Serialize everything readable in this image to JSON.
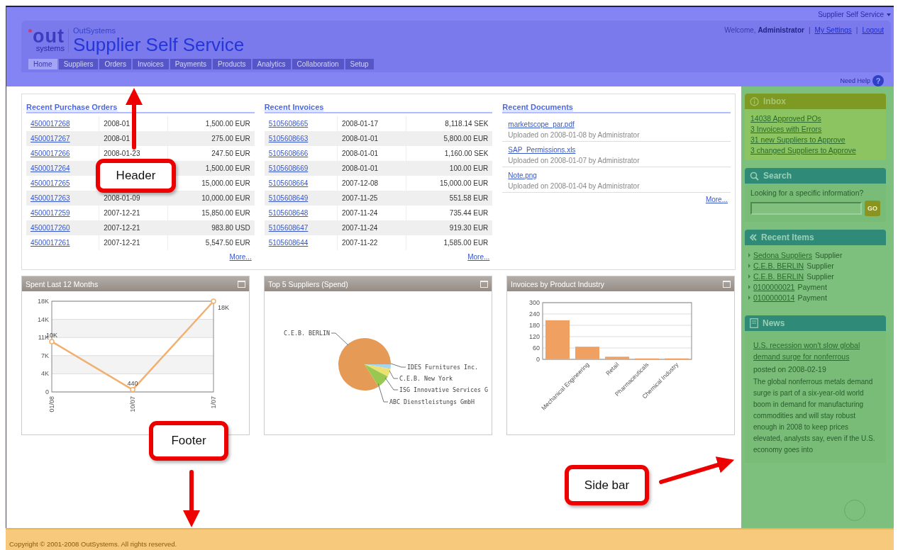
{
  "header": {
    "app_switcher": "Supplier Self Service",
    "logo": {
      "mark": "out",
      "sub": "systems"
    },
    "brand": "OutSystems",
    "title": "Supplier Self Service",
    "welcome": "Welcome, **Administrator**",
    "separator": "|",
    "links": [
      "My Settings",
      "Logout"
    ],
    "tabs": [
      {
        "label": "Home",
        "selected": true
      },
      {
        "label": "Suppliers",
        "selected": false
      },
      {
        "label": "Orders",
        "selected": false
      },
      {
        "label": "Invoices",
        "selected": false
      },
      {
        "label": "Payments",
        "selected": false
      },
      {
        "label": "Products",
        "selected": false
      },
      {
        "label": "Analytics",
        "selected": false
      },
      {
        "label": "Collaboration",
        "selected": false
      },
      {
        "label": "Setup",
        "selected": false
      }
    ],
    "help": {
      "label": "Need Help",
      "icon": "?"
    }
  },
  "purchase_orders": {
    "title": "Recent Purchase Orders",
    "more": "More...",
    "rows": [
      {
        "number": "4500017268",
        "date": "2008-01",
        "amount": "1,500.00 EUR"
      },
      {
        "number": "4500017267",
        "date": "2008-01",
        "amount": "275.00 EUR"
      },
      {
        "number": "4500017266",
        "date": "2008-01-23",
        "amount": "247.50 EUR"
      },
      {
        "number": "4500017264",
        "amount": "1,500.00 EUR"
      },
      {
        "number": "4500017265",
        "amount": "15,000.00 EUR"
      },
      {
        "number": "4500017263",
        "date": "2008-01-09",
        "amount": "10,000.00 EUR"
      },
      {
        "number": "4500017259",
        "date": "2007-12-21",
        "amount": "15,850.00 EUR"
      },
      {
        "number": "4500017260",
        "date": "2007-12-21",
        "amount": "983.80 USD"
      },
      {
        "number": "4500017261",
        "date": "2007-12-21",
        "amount": "5,547.50 EUR"
      }
    ]
  },
  "invoices": {
    "title": "Recent Invoices",
    "more": "More...",
    "rows": [
      {
        "number": "5105608665",
        "date": "2008-01-17",
        "amount": "8,118.14 SEK"
      },
      {
        "number": "5105608663",
        "date": "2008-01-01",
        "amount": "5,800.00 EUR"
      },
      {
        "number": "5105608666",
        "date": "2008-01-01",
        "amount": "1,160.00 SEK"
      },
      {
        "number": "5105608669",
        "date": "2008-01-01",
        "amount": "100.00 EUR"
      },
      {
        "number": "5105608664",
        "date": "2007-12-08",
        "amount": "15,000.00 EUR"
      },
      {
        "number": "5105608649",
        "date": "2007-11-25",
        "amount": "551.58 EUR"
      },
      {
        "number": "5105608648",
        "date": "2007-11-24",
        "amount": "735.44 EUR"
      },
      {
        "number": "5105608647",
        "date": "2007-11-24",
        "amount": "919.30 EUR"
      },
      {
        "number": "5105608644",
        "date": "2007-11-22",
        "amount": "1,585.00 EUR"
      }
    ]
  },
  "documents": {
    "title": "Recent Documents",
    "more": "More...",
    "items": [
      {
        "name": "marketscope_par.pdf",
        "info": "Uploaded on 2008-01-08 by Administrator"
      },
      {
        "name": "SAP_Permissions.xls",
        "info": "Uploaded on 2008-01-07 by Administrator"
      },
      {
        "name": "Note.png",
        "info": "Uploaded on 2008-01-04 by Administrator"
      }
    ]
  },
  "spent_chart": {
    "title": "Spent Last 12 Months",
    "chart_data": {
      "type": "line",
      "categories": [
        "01/08",
        "10/07",
        "1/07"
      ],
      "series": [
        {
          "color": "#f0b070",
          "marker": "o",
          "values": [
            10000,
            440,
            18000
          ]
        }
      ],
      "grid": true,
      "ylim": [
        0,
        18000
      ],
      "yticks": [
        {
          "value": 0,
          "label": "0"
        },
        {
          "value": 3600,
          "label": "4K"
        },
        {
          "value": 7200,
          "label": "7K"
        },
        {
          "value": 10800,
          "label": "11K"
        },
        {
          "value": 14400,
          "label": "14K"
        },
        {
          "value": 18000,
          "label": "18K"
        }
      ],
      "value_labels": [
        "10K",
        "440",
        "18K"
      ]
    }
  },
  "suppliers_chart": {
    "title": "Top 5 Suppliers (Spend)",
    "labels": [
      "C.E.B. BERLIN",
      "IDES Furnitures Inc.",
      "C.E.B. New York",
      "ISG Innovative Services G",
      "ABC Dienstleistungs GmbH"
    ]
  },
  "industry_chart": {
    "title": "Invoices by Product Industry",
    "chart_data": {
      "type": "bar",
      "categories": [
        null,
        "Mechanical Engineering",
        "Retail",
        "Pharmaceuticals",
        "Chemical Industry"
      ],
      "series": [
        {
          "color": "#f0a060",
          "values": [
            205,
            65,
            12,
            3,
            3
          ]
        }
      ],
      "grid": true,
      "ylim": [
        0,
        300
      ],
      "yticks": [
        0,
        60,
        120,
        180,
        240,
        300
      ]
    }
  },
  "sidebar": {
    "inbox": {
      "title": "Inbox",
      "items": [
        "14038 Approved POs",
        "3 Invoices with Errors",
        "31 new Suppliers to Approve",
        "3 changed Suppliers to Approve"
      ]
    },
    "search": {
      "title": "Search",
      "prompt": "Looking for a specific information?",
      "button": "GO"
    },
    "recent": {
      "title": "Recent Items",
      "items": [
        {
          "name": "Sedona Suppliers",
          "type": "Supplier"
        },
        {
          "name": "C.E.B. BERLIN",
          "type": "Supplier"
        },
        {
          "name": "C.E.B. BERLIN",
          "type": "Supplier"
        },
        {
          "name": "0100000021",
          "type": "Payment"
        },
        {
          "name": "0100000014",
          "type": "Payment"
        }
      ]
    },
    "news": {
      "title": "News",
      "headline": "U.S. recession won't slow global demand surge for nonferrous",
      "posted": "posted on 2008-02-19",
      "body": "The global nonferrous metals demand surge is part of a six-year-old world boom in demand for manufacturing commodities and will stay robust enough in 2008 to keep prices elevated, analysts say, even if the U.S. economy goes into"
    }
  },
  "footer": {
    "copyright": "Copyright © 2001-2008 OutSystems. All rights reserved."
  },
  "callouts": [
    {
      "label": "Header"
    },
    {
      "label": "Footer"
    },
    {
      "label": "Side bar"
    }
  ]
}
